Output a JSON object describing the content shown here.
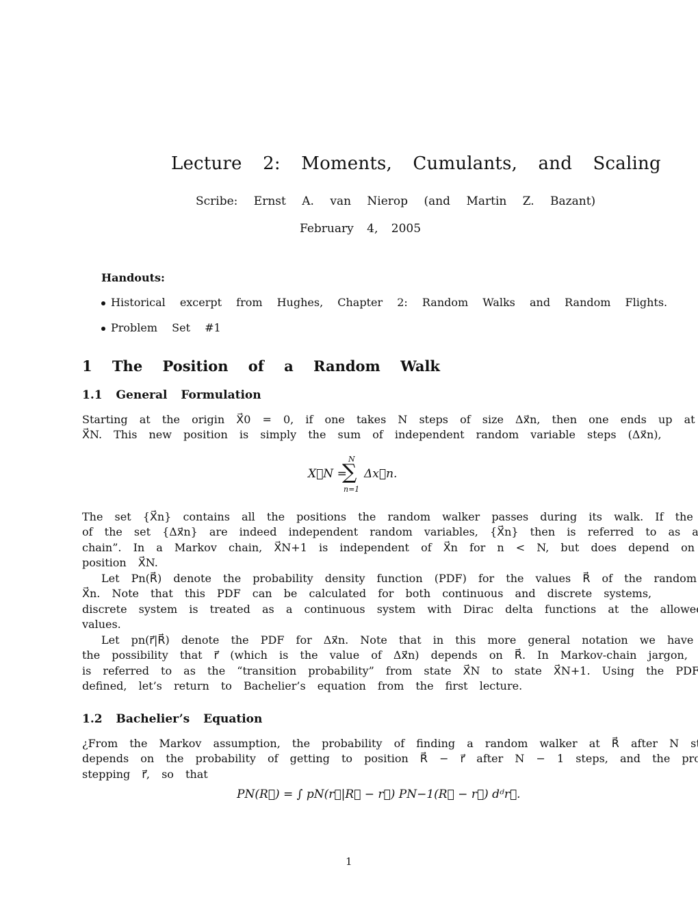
{
  "header": {
    "title": "Lecture 2: Moments, Cumulants, and Scaling",
    "scribe": "Scribe: Ernst A. van Nierop (and Martin Z. Bazant)",
    "date": "February 4, 2005"
  },
  "handouts": {
    "heading": "Handouts:",
    "items": [
      "Historical excerpt from Hughes, Chapter 2: Random Walks and Random Flights.",
      "Problem Set #1"
    ]
  },
  "section1": {
    "heading": "1 The Position of a Random Walk",
    "sub1": {
      "heading": "1.1 General Formulation",
      "para1": [
        "Starting at the origin X⃗0 = 0, if one takes N steps of size Δx⃗n, then one ends up at the new position",
        "X⃗N. This new position is simply the sum of independent random variable steps (Δx⃗n),"
      ],
      "equation1": {
        "lhs": "X⃗N =",
        "sum_upper": "N",
        "sum_lower": "n=1",
        "rhs": "Δx⃗n."
      },
      "para2": [
        "The set {X⃗n} contains all the positions the random walker passes during its walk. If the",
        "of the set {Δx⃗n} are indeed independent random variables, {X⃗n} then is referred to as a “Markov",
        "chain”. In a Markov chain, X⃗N+1 is independent of X⃗n for n < N, but does depend on the previous",
        "position X⃗N."
      ],
      "para3": [
        "Let Pn(R⃗) denote the probability density function (PDF) for the values R⃗ of the random variable",
        "X⃗n. Note that this PDF can be calculated for both continuous and discrete systems,",
        "discrete system is treated as a continuous system with Dirac delta functions at the allowed",
        "values."
      ],
      "para4": [
        "Let pn(r⃗|R⃗) denote the PDF for Δx⃗n. Note that in this more general notation we have inclu",
        "the possibility that r⃗ (which is the value of Δx⃗n) depends on R⃗. In Markov-chain jargon, pn(r⃗|R⃗)",
        "is referred to as the “transition probability” from state X⃗N to state X⃗N+1. Using the PDFs we just",
        "defined, let’s return to Bachelier’s equation from the first lecture."
      ]
    },
    "sub2": {
      "heading": "1.2 Bachelier’s Equation",
      "para1": [
        "¿From the Markov assumption, the probability of finding a random walker at R⃗ after N steps",
        "depends on the probability of getting to position R⃗ − r⃗ after N − 1 steps, and the probability of",
        "stepping r⃗, so that"
      ],
      "equation2": "PN(R⃗) = ∫ pN(r⃗|R⃗ − r⃗) PN−1(R⃗ − r⃗) dᵈr⃗."
    }
  },
  "footer": {
    "page_number": "1"
  }
}
